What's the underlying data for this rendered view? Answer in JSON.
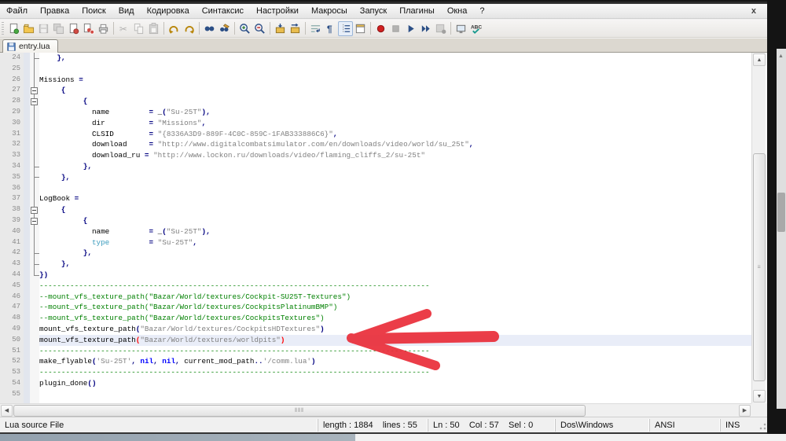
{
  "window": {
    "close_label": "x"
  },
  "menu": {
    "items": [
      "Файл",
      "Правка",
      "Поиск",
      "Вид",
      "Кодировка",
      "Синтаксис",
      "Настройки",
      "Макросы",
      "Запуск",
      "Плагины",
      "Окна",
      "?"
    ]
  },
  "toolbar": {
    "icons": [
      {
        "name": "new-file"
      },
      {
        "name": "open-file"
      },
      {
        "name": "save",
        "disabled": true
      },
      {
        "name": "save-all",
        "disabled": true
      },
      {
        "name": "close-document"
      },
      {
        "name": "close-all-documents"
      },
      {
        "name": "print"
      },
      {
        "sep": true
      },
      {
        "name": "cut",
        "disabled": true
      },
      {
        "name": "copy",
        "disabled": true
      },
      {
        "name": "paste",
        "disabled": true
      },
      {
        "sep": true
      },
      {
        "name": "undo"
      },
      {
        "name": "redo"
      },
      {
        "sep": true
      },
      {
        "name": "find"
      },
      {
        "name": "replace"
      },
      {
        "sep": true
      },
      {
        "name": "zoom-in"
      },
      {
        "name": "zoom-out"
      },
      {
        "sep": true
      },
      {
        "name": "sync-vertical-scroll"
      },
      {
        "name": "sync-horizontal-scroll"
      },
      {
        "sep": true
      },
      {
        "name": "word-wrap"
      },
      {
        "name": "show-all-characters"
      },
      {
        "name": "show-indent-guide",
        "pressed": true
      },
      {
        "name": "user-defined-dialog"
      },
      {
        "sep": true
      },
      {
        "name": "record-macro"
      },
      {
        "name": "stop-macro",
        "disabled": true
      },
      {
        "name": "play-macro"
      },
      {
        "name": "run-macro-multiple"
      },
      {
        "name": "save-macro",
        "disabled": true
      },
      {
        "sep": true
      },
      {
        "name": "document-monitor"
      },
      {
        "name": "spell-check"
      }
    ]
  },
  "tab": {
    "title": "entry.lua"
  },
  "editor": {
    "first_line": 24,
    "current_line": 50,
    "lines": [
      {
        "n": 24,
        "fold": "tick",
        "t": [
          [
            "p",
            "    },"
          ]
        ]
      },
      {
        "n": 25,
        "fold": "line",
        "t": []
      },
      {
        "n": 26,
        "fold": "line",
        "t": [
          [
            "d",
            "Missions "
          ],
          [
            "p",
            "="
          ]
        ]
      },
      {
        "n": 27,
        "fold": "box",
        "t": [
          [
            "p",
            "     {"
          ]
        ]
      },
      {
        "n": 28,
        "fold": "box",
        "t": [
          [
            "p",
            "          {"
          ]
        ]
      },
      {
        "n": 29,
        "fold": "line",
        "t": [
          [
            "d",
            "            name         "
          ],
          [
            "p",
            "= "
          ],
          [
            "d",
            "_"
          ],
          [
            "p",
            "("
          ],
          [
            "s",
            "\"Su-25T\""
          ],
          [
            "p",
            "),"
          ]
        ]
      },
      {
        "n": 30,
        "fold": "line",
        "t": [
          [
            "d",
            "            dir          "
          ],
          [
            "p",
            "= "
          ],
          [
            "s",
            "\"Missions\""
          ],
          [
            "p",
            ","
          ]
        ]
      },
      {
        "n": 31,
        "fold": "line",
        "t": [
          [
            "d",
            "            CLSID        "
          ],
          [
            "p",
            "= "
          ],
          [
            "s",
            "\"{8336A3D9-889F-4C0C-859C-1FAB333886C6}\""
          ],
          [
            "p",
            ","
          ]
        ]
      },
      {
        "n": 32,
        "fold": "line",
        "t": [
          [
            "d",
            "            download     "
          ],
          [
            "p",
            "= "
          ],
          [
            "s",
            "\"http://www.digitalcombatsimulator.com/en/downloads/video/world/su_25t\""
          ],
          [
            "p",
            ","
          ]
        ]
      },
      {
        "n": 33,
        "fold": "line",
        "t": [
          [
            "d",
            "            download_ru "
          ],
          [
            "p",
            "= "
          ],
          [
            "s",
            "\"http://www.lockon.ru/downloads/video/flaming_cliffs_2/su-25t\""
          ]
        ]
      },
      {
        "n": 34,
        "fold": "tick",
        "t": [
          [
            "p",
            "          },"
          ]
        ]
      },
      {
        "n": 35,
        "fold": "tick",
        "t": [
          [
            "p",
            "     },"
          ]
        ]
      },
      {
        "n": 36,
        "fold": "line",
        "t": []
      },
      {
        "n": 37,
        "fold": "line",
        "t": [
          [
            "d",
            "LogBook "
          ],
          [
            "p",
            "="
          ]
        ]
      },
      {
        "n": 38,
        "fold": "box",
        "t": [
          [
            "p",
            "     {"
          ]
        ]
      },
      {
        "n": 39,
        "fold": "box",
        "t": [
          [
            "p",
            "          {"
          ]
        ]
      },
      {
        "n": 40,
        "fold": "line",
        "t": [
          [
            "d",
            "            name         "
          ],
          [
            "p",
            "= "
          ],
          [
            "d",
            "_"
          ],
          [
            "p",
            "("
          ],
          [
            "s",
            "\"Su-25T\""
          ],
          [
            "p",
            "),"
          ]
        ]
      },
      {
        "n": 41,
        "fold": "line",
        "t": [
          [
            "f",
            "            type"
          ],
          [
            "d",
            "         "
          ],
          [
            "p",
            "= "
          ],
          [
            "s",
            "\"Su-25T\""
          ],
          [
            "p",
            ","
          ]
        ]
      },
      {
        "n": 42,
        "fold": "tick",
        "t": [
          [
            "p",
            "          },"
          ]
        ]
      },
      {
        "n": 43,
        "fold": "tick",
        "t": [
          [
            "p",
            "     },"
          ]
        ]
      },
      {
        "n": 44,
        "fold": "corner",
        "t": [
          [
            "p",
            "})"
          ]
        ]
      },
      {
        "n": 45,
        "t": [
          [
            "c",
            "-----------------------------------------------------------------------------------------"
          ]
        ]
      },
      {
        "n": 46,
        "t": [
          [
            "c",
            "--mount_vfs_texture_path(\"Bazar/World/textures/Cockpit-SU25T-Textures\")"
          ]
        ]
      },
      {
        "n": 47,
        "t": [
          [
            "c",
            "--mount_vfs_texture_path(\"Bazar/World/textures/CockpitsPlatinumBMP\")"
          ]
        ]
      },
      {
        "n": 48,
        "t": [
          [
            "c",
            "--mount_vfs_texture_path(\"Bazar/World/textures/CockpitsTextures\")"
          ]
        ]
      },
      {
        "n": 49,
        "t": [
          [
            "d",
            "mount_vfs_texture_path"
          ],
          [
            "p",
            "("
          ],
          [
            "s",
            "\"Bazar/World/textures/CockpitsHDTextures\""
          ],
          [
            "p",
            ")"
          ]
        ]
      },
      {
        "n": 50,
        "cur": true,
        "t": [
          [
            "d",
            "mount_vfs_texture_path"
          ],
          [
            "r",
            "("
          ],
          [
            "s",
            "\"Bazar/World/textures/worldpits\""
          ],
          [
            "r",
            ")"
          ]
        ]
      },
      {
        "n": 51,
        "t": [
          [
            "c",
            "-----------------------------------------------------------------------------------------"
          ]
        ]
      },
      {
        "n": 52,
        "t": [
          [
            "d",
            "make_flyable"
          ],
          [
            "p",
            "("
          ],
          [
            "s",
            "'Su-25T'"
          ],
          [
            "p",
            ", "
          ],
          [
            "k",
            "nil"
          ],
          [
            "p",
            ", "
          ],
          [
            "k",
            "nil"
          ],
          [
            "p",
            ", "
          ],
          [
            "d",
            "current_mod_path"
          ],
          [
            "p",
            ".."
          ],
          [
            "s",
            "'/comm.lua'"
          ],
          [
            "p",
            ")"
          ]
        ]
      },
      {
        "n": 53,
        "t": [
          [
            "c",
            "-----------------------------------------------------------------------------------------"
          ]
        ]
      },
      {
        "n": 54,
        "t": [
          [
            "d",
            "plugin_done"
          ],
          [
            "p",
            "()"
          ]
        ]
      },
      {
        "n": 55,
        "t": []
      }
    ]
  },
  "annotation": {
    "shape": "hand-drawn-left-arrow",
    "color": "#ea2f3b",
    "points_to_line": 50
  },
  "statusbar": {
    "doc_type": "Lua source File",
    "length_lines": "length : 1884    lines : 55",
    "position": "Ln : 50    Col : 57    Sel : 0",
    "eol_format": "Dos\\Windows",
    "encoding": "ANSI",
    "insert_mode": "INS"
  },
  "colors": {
    "comment": "#008000",
    "string": "#808080",
    "operator": "#000080",
    "keyword": "#0000ff",
    "basic_function": "#3a9bbd",
    "brace_match": "#ff0000",
    "current_line_bg": "#e9edf8",
    "annotation_red": "#ea2f3b"
  }
}
